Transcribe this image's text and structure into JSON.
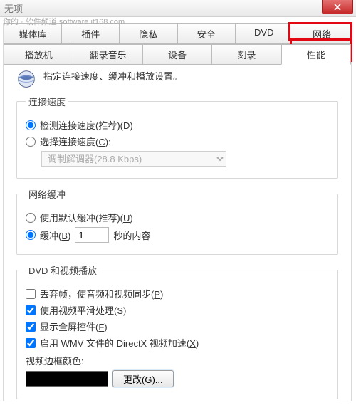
{
  "window": {
    "title": "无项",
    "watermark": "你的 · 软件频道 software.it168.com"
  },
  "tabs": {
    "row1": [
      "媒体库",
      "插件",
      "隐私",
      "安全",
      "DVD",
      "网络"
    ],
    "row2": [
      "播放机",
      "翻录音乐",
      "设备",
      "刻录",
      "性能"
    ],
    "active": "性能"
  },
  "intro": "指定连接速度、缓冲和播放设置。",
  "conn": {
    "legend": "连接速度",
    "detect_label": "检测连接速度(推荐)(",
    "detect_key": "D",
    "detect_after": ")",
    "select_label": "选择连接速度(",
    "select_key": "C",
    "select_after": "):",
    "combo": "调制解调器(28.8 Kbps)"
  },
  "buffer": {
    "legend": "网络缓冲",
    "default_label": "使用默认缓冲(推荐)(",
    "default_key": "U",
    "default_after": ")",
    "custom_label": "缓冲(",
    "custom_key": "B",
    "custom_after": ")",
    "value": "1",
    "unit": "秒的内容"
  },
  "dvd": {
    "legend": "DVD 和视频播放",
    "drop_label": "丢弃帧，使音频和视频同步(",
    "drop_key": "P",
    "drop_after": ")",
    "smooth_label": "使用视频平滑处理(",
    "smooth_key": "S",
    "smooth_after": ")",
    "fs_label": "显示全屏控件(",
    "fs_key": "F",
    "fs_after": ")",
    "dx_label": "启用 WMV 文件的 DirectX 视频加速(",
    "dx_key": "X",
    "dx_after": ")",
    "border_label": "视频边框颜色:",
    "change_label": "更改(",
    "change_key": "G",
    "change_after": ")..."
  }
}
